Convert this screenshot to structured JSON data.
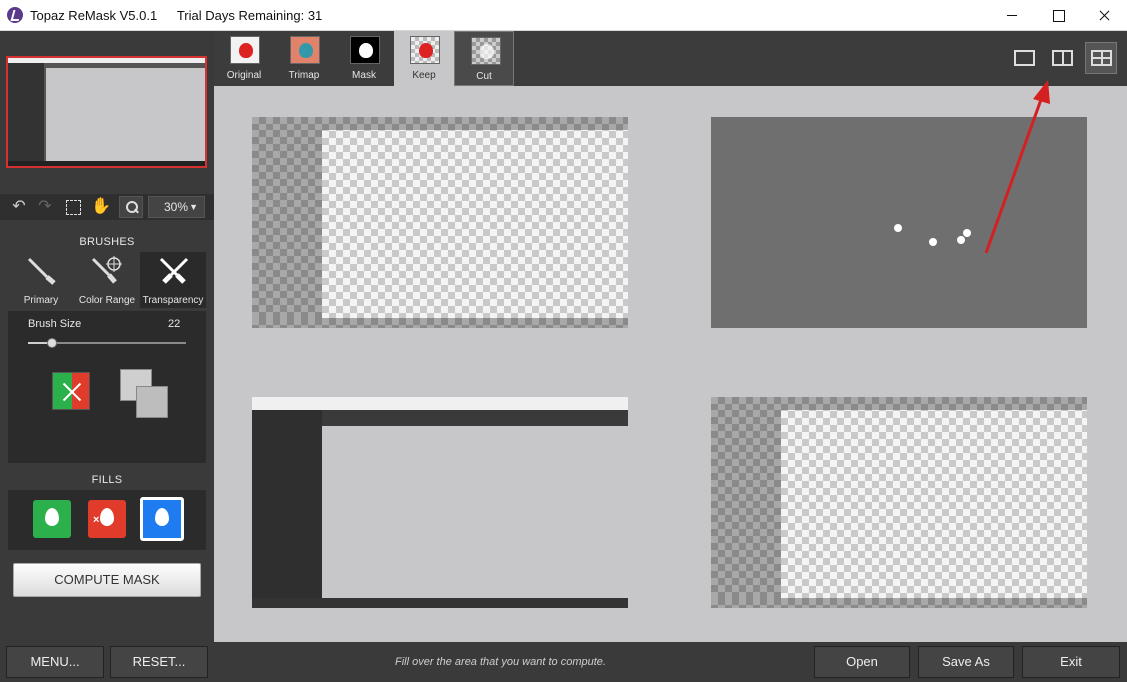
{
  "window": {
    "app_name": "Topaz ReMask V5.0.1",
    "trial_text": "Trial Days Remaining: 31"
  },
  "toolbar": {
    "zoom_value": "30%"
  },
  "brushes": {
    "title": "BRUSHES",
    "items": [
      {
        "label": "Primary"
      },
      {
        "label": "Color Range"
      },
      {
        "label": "Transparency"
      }
    ],
    "brush_size_label": "Brush Size",
    "brush_size_value": "22",
    "slider_fraction": 0.15
  },
  "fills": {
    "title": "FILLS"
  },
  "compute_button": "COMPUTE MASK",
  "view_tabs": [
    {
      "label": "Original"
    },
    {
      "label": "Trimap"
    },
    {
      "label": "Mask"
    },
    {
      "label": "Keep"
    },
    {
      "label": "Cut"
    }
  ],
  "bottom": {
    "menu": "MENU...",
    "reset": "RESET...",
    "hint": "Fill over the area that you want to compute.",
    "open": "Open",
    "save_as": "Save As",
    "exit": "Exit"
  },
  "colors": {
    "accent_red": "#d5312e",
    "keep_green": "#2cb04b",
    "cut_red": "#e03b2b",
    "compute_blue": "#1e7cf0"
  }
}
